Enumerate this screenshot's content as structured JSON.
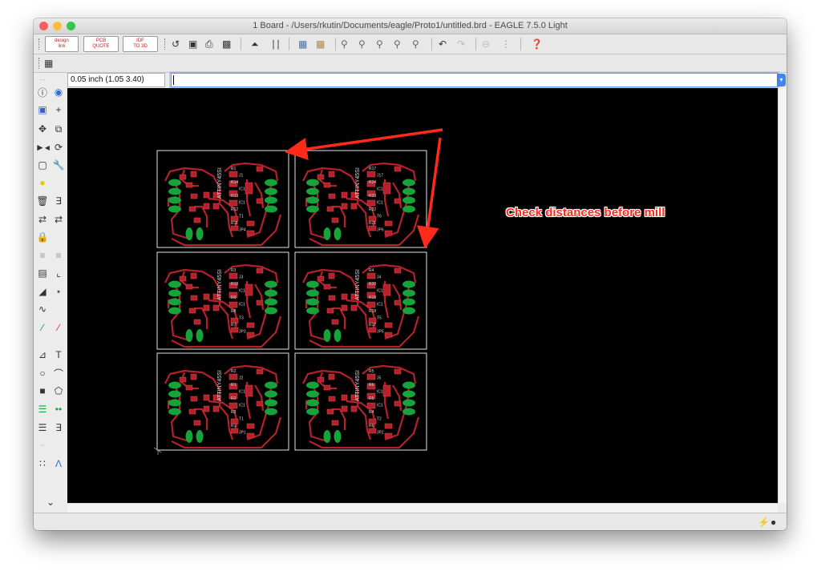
{
  "window": {
    "title": "1 Board - /Users/rkutin/Documents/eagle/Proto1/untitled.brd - EAGLE 7.5.0 Light",
    "traffic_lights": {
      "close": "#fc605c",
      "minimize": "#fdbc40",
      "zoom": "#34c84a"
    }
  },
  "toolbar": {
    "design_link": [
      "design",
      "link"
    ],
    "pcb_quote": [
      "PCB",
      "QUOTE"
    ],
    "idf": [
      "IDF",
      "TO 3D"
    ],
    "icons": [
      "open-icon",
      "save-icon",
      "print-icon",
      "cam-icon",
      "script-icon",
      "ulp-icon",
      "layers-icon",
      "layer-select-icon",
      "zoom-fit-icon",
      "zoom-in-icon",
      "zoom-out-icon",
      "zoom-redraw-icon",
      "zoom-select-icon",
      "undo-icon",
      "redo-icon",
      "stop-icon",
      "go-icon",
      "help-icon"
    ]
  },
  "command": {
    "coordinate": "0.05 inch (1.05 3.40)",
    "value": ""
  },
  "canvas": {
    "background": "#000000",
    "annotation": "Check distances before mill",
    "annotation_color": "#ff2a1a",
    "trace_color": "#b3212b",
    "pad_color": "#15a33a",
    "outline_color": "#e3e3e3"
  },
  "boards": [
    {
      "row": 1,
      "col": 1,
      "labels": [
        "R1",
        "J1",
        "R14",
        "IC1",
        "R13",
        "IC1",
        "R12",
        "T1",
        "R11",
        "JP4"
      ]
    },
    {
      "row": 1,
      "col": 2,
      "labels": [
        "R17",
        "J17",
        "R24",
        "IC1",
        "R23",
        "IC1",
        "R22",
        "T6",
        "R21",
        "JP6"
      ]
    },
    {
      "row": 2,
      "col": 1,
      "labels": [
        "R3",
        "J3",
        "R10",
        "IC1",
        "R9",
        "IC1",
        "R8",
        "T3",
        "R7",
        "JP3"
      ]
    },
    {
      "row": 2,
      "col": 2,
      "labels": [
        "R4",
        "J4",
        "R20",
        "IC1",
        "R19",
        "IC1",
        "R18",
        "T5",
        "R17",
        "JP5"
      ]
    },
    {
      "row": 3,
      "col": 1,
      "labels": [
        "R2",
        "J2",
        "R1",
        "IC1",
        "R2",
        "IC1",
        "R3",
        "T1",
        "R1",
        "JP1"
      ]
    },
    {
      "row": 3,
      "col": 2,
      "labels": [
        "R5",
        "J5",
        "R6",
        "IC1",
        "R5",
        "IC1",
        "R4",
        "T2",
        "R6",
        "JP2"
      ]
    }
  ],
  "board_text": "ATTINY45SI"
}
